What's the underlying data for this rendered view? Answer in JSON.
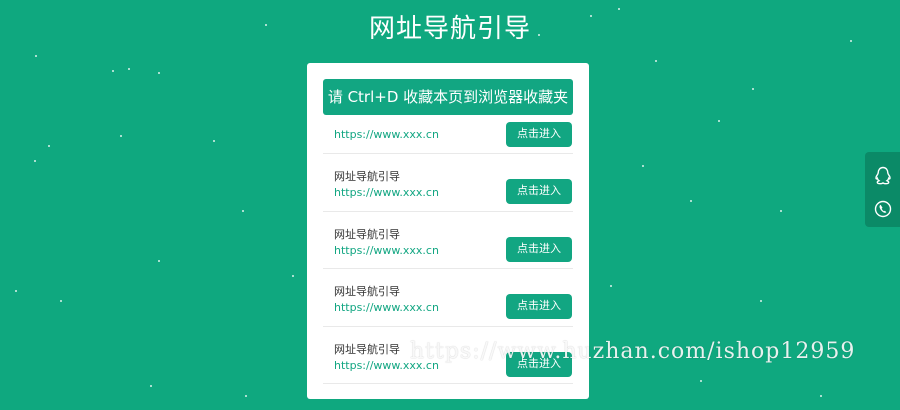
{
  "page": {
    "title": "网址导航引导"
  },
  "bookmark_hint": "请 Ctrl+D 收藏本页到浏览器收藏夹",
  "items": [
    {
      "title": "",
      "url": "https://www.xxx.cn",
      "button": "点击进入"
    },
    {
      "title": "网址导航引导",
      "url": "https://www.xxx.cn",
      "button": "点击进入"
    },
    {
      "title": "网址导航引导",
      "url": "https://www.xxx.cn",
      "button": "点击进入"
    },
    {
      "title": "网址导航引导",
      "url": "https://www.xxx.cn",
      "button": "点击进入"
    },
    {
      "title": "网址导航引导",
      "url": "https://www.xxx.cn",
      "button": "点击进入"
    }
  ],
  "side_panel": {
    "icons": [
      "qq-icon",
      "phone-icon"
    ]
  },
  "watermark": "https://www.huzhan.com/ishop12959",
  "colors": {
    "background": "#0fa87f",
    "accent": "#12a682",
    "side_panel": "#0b8a67"
  }
}
